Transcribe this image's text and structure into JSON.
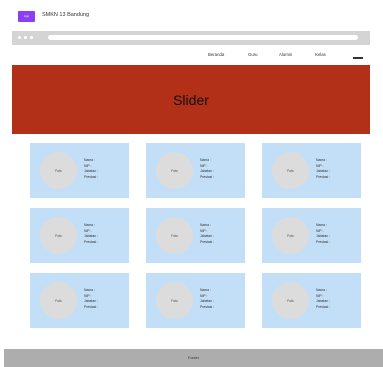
{
  "app": {
    "title": "SMKN 13 Bandung",
    "logo_text": "logo",
    "logo_color": "#8b3ff5"
  },
  "nav": {
    "items": [
      "Beranda",
      "Guru",
      "Alumni",
      "Kelas"
    ]
  },
  "slider": {
    "title": "Slider",
    "color": "#b22f18"
  },
  "cards": [
    {
      "avatar": "Foto",
      "lines": [
        "Nama :",
        "NIP :",
        "Jabatan :",
        "Prestasi :"
      ]
    },
    {
      "avatar": "Foto",
      "lines": [
        "Nama :",
        "NIP :",
        "Jabatan :",
        "Prestasi :"
      ]
    },
    {
      "avatar": "Foto",
      "lines": [
        "Nama :",
        "NIP :",
        "Jabatan :",
        "Prestasi :"
      ]
    },
    {
      "avatar": "Foto",
      "lines": [
        "Nama :",
        "NIP :",
        "Jabatan :",
        "Prestasi :"
      ]
    },
    {
      "avatar": "Foto",
      "lines": [
        "Nama :",
        "NIP :",
        "Jabatan :",
        "Prestasi :"
      ]
    },
    {
      "avatar": "Foto",
      "lines": [
        "Nama :",
        "NIP :",
        "Jabatan :",
        "Prestasi :"
      ]
    },
    {
      "avatar": "Foto",
      "lines": [
        "Nama :",
        "NIP :",
        "Jabatan :",
        "Prestasi :"
      ]
    },
    {
      "avatar": "Foto",
      "lines": [
        "Nama :",
        "NIP :",
        "Jabatan :",
        "Prestasi :"
      ]
    },
    {
      "avatar": "Foto",
      "lines": [
        "Nama :",
        "NIP :",
        "Jabatan :",
        "Prestasi :"
      ]
    }
  ],
  "footer": {
    "text": "Footer"
  },
  "colors": {
    "card": "#c3def7",
    "browser_bar": "#d4d4d4",
    "footer": "#adadad"
  }
}
